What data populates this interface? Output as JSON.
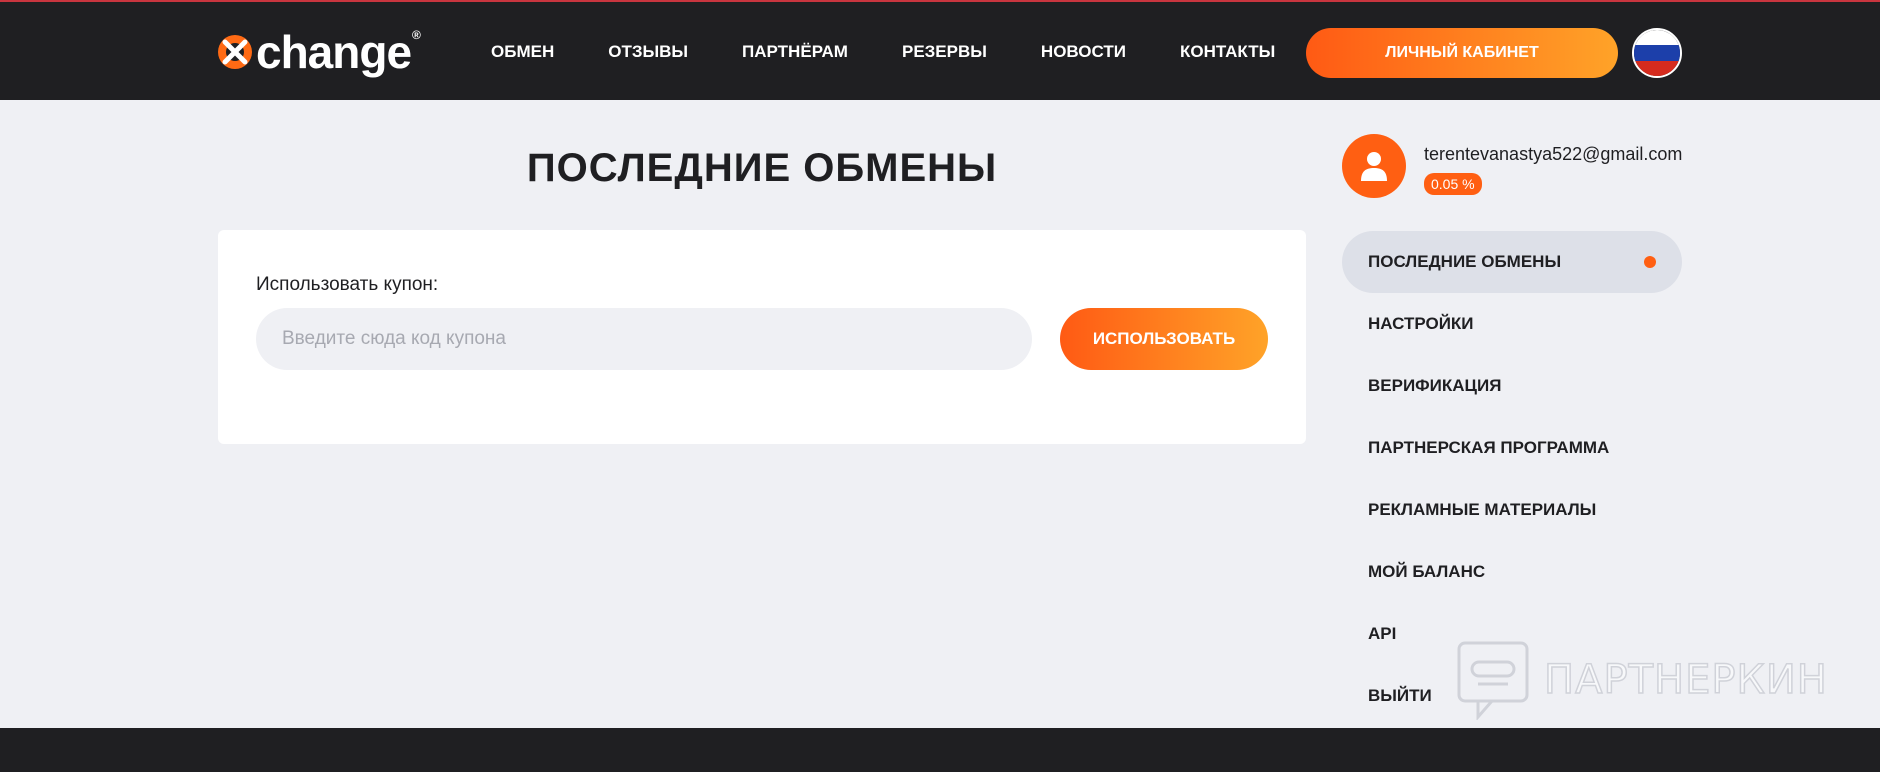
{
  "header": {
    "logo_text": "change",
    "logo_reg": "®",
    "nav": [
      {
        "label": "ОБМЕН"
      },
      {
        "label": "ОТЗЫВЫ"
      },
      {
        "label": "ПАРТНЁРАМ"
      },
      {
        "label": "РЕЗЕРВЫ"
      },
      {
        "label": "НОВОСТИ"
      },
      {
        "label": "КОНТАКТЫ"
      }
    ],
    "cabinet_label": "ЛИЧНЫЙ КАБИНЕТ",
    "language_flag": "russia-flag-icon"
  },
  "main": {
    "title": "ПОСЛЕДНИЕ ОБМЕНЫ",
    "coupon": {
      "label": "Использовать купон:",
      "placeholder": "Введите сюда код купона",
      "value": "",
      "button_label": "ИСПОЛЬЗОВАТЬ"
    }
  },
  "sidebar": {
    "email": "terentevanastya522@gmail.com",
    "percent": "0.05 %",
    "items": [
      {
        "label": "ПОСЛЕДНИЕ ОБМЕНЫ",
        "active": true
      },
      {
        "label": "НАСТРОЙКИ"
      },
      {
        "label": "ВЕРИФИКАЦИЯ"
      },
      {
        "label": "ПАРТНЕРСКАЯ ПРОГРАММА"
      },
      {
        "label": "РЕКЛАМНЫЕ МАТЕРИАЛЫ"
      },
      {
        "label": "МОЙ БАЛАНС"
      },
      {
        "label": "API"
      },
      {
        "label": "ВЫЙТИ"
      }
    ]
  },
  "watermark": {
    "text": "ПАРТНЕРКИН"
  },
  "colors": {
    "accent": "#ff5f12",
    "accent_gradient_end": "#ffa328",
    "header_bg": "#1f1f22",
    "page_bg": "#eff0f4",
    "active_item_bg": "#dde0e8"
  }
}
